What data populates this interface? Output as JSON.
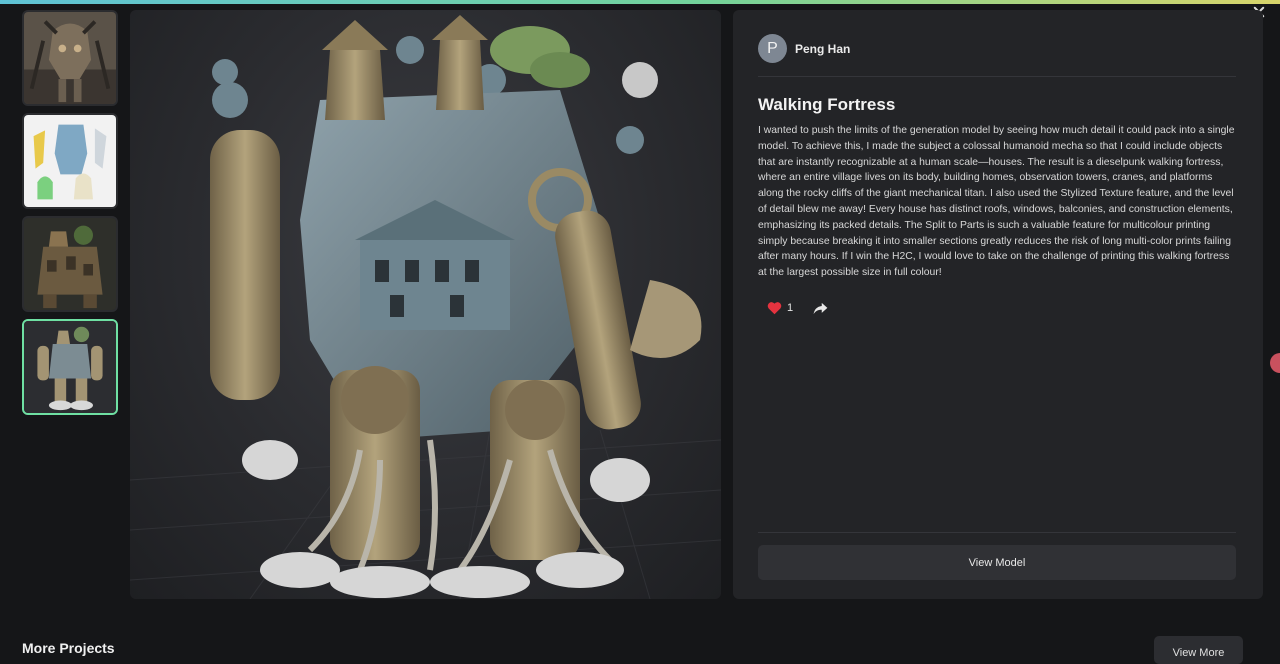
{
  "author": {
    "initial": "P",
    "name": "Peng Han"
  },
  "project": {
    "title": "Walking Fortress",
    "description": "I wanted to push the limits of the generation model by seeing how much detail it could pack into a single model. To achieve this, I made the subject a colossal humanoid mecha so that I could include objects that are instantly recognizable at a human scale—houses. The result is a dieselpunk walking fortress, where an entire village lives on its body, building homes, observation towers, cranes, and platforms along the rocky cliffs of the giant mechanical titan. I also used the Stylized Texture feature, and the level of detail blew me away! Every house has distinct roofs, windows, balconies, and construction elements, emphasizing its packed details. The Split to Parts is such a valuable feature for multicolour printing simply because breaking it into smaller sections greatly reduces the risk of long multi-color prints failing after many hours. If I win the H2C, I would love to take on the challenge of printing this walking fortress at the largest possible size in full colour!",
    "like_count": "1"
  },
  "buttons": {
    "view_model": "View Model",
    "view_more": "View More"
  },
  "sections": {
    "more_projects": "More Projects"
  },
  "thumbnails": [
    {
      "subject": "mech-predator-thumbnail"
    },
    {
      "subject": "split-parts-thumbnail"
    },
    {
      "subject": "textured-fortress-thumbnail"
    },
    {
      "subject": "walking-fortress-thumbnail",
      "active": true
    }
  ],
  "icons": {
    "like": "heart-icon",
    "share": "share-icon",
    "close": "close-icon"
  },
  "colors": {
    "accent": "#6fe0a3",
    "heart": "#e5333f",
    "panel": "#232427",
    "background": "#151618"
  }
}
